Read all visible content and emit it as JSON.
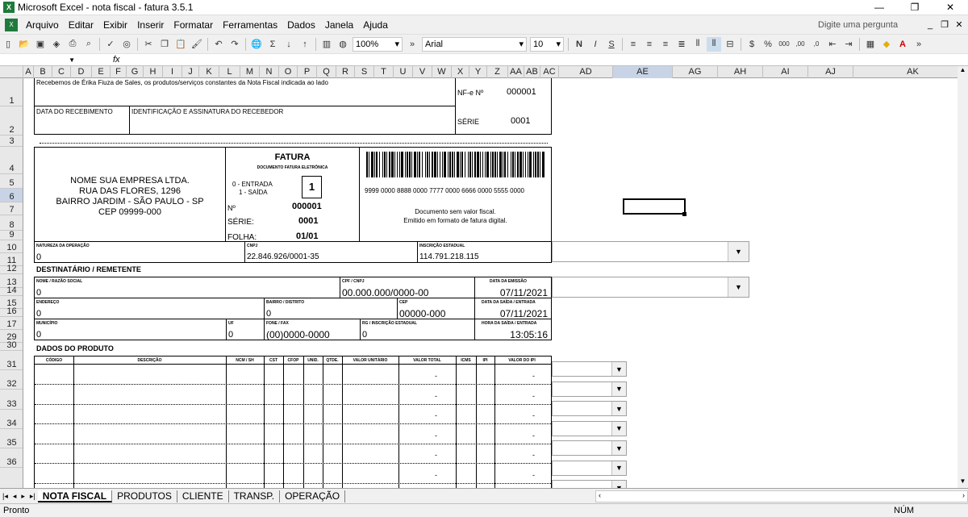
{
  "window": {
    "title": "Microsoft Excel - nota fiscal - fatura 3.5.1",
    "minimize": "—",
    "restore": "❐",
    "close": "✕"
  },
  "menu": {
    "items": [
      "Arquivo",
      "Editar",
      "Exibir",
      "Inserir",
      "Formatar",
      "Ferramentas",
      "Dados",
      "Janela",
      "Ajuda"
    ],
    "help_placeholder": "Digite uma pergunta"
  },
  "toolbar": {
    "zoom": "100%",
    "font": "Arial",
    "size": "10"
  },
  "formula": {
    "fx": "fx"
  },
  "columns": [
    "A",
    "B",
    "C",
    "D",
    "E",
    "F",
    "G",
    "H",
    "I",
    "J",
    "K",
    "L",
    "M",
    "N",
    "O",
    "P",
    "Q",
    "R",
    "S",
    "T",
    "U",
    "V",
    "W",
    "X",
    "Y",
    "Z",
    "AA",
    "AB",
    "AC",
    "AD",
    "AE",
    "AG",
    "AH",
    "AI",
    "AJ",
    "AK"
  ],
  "rows": [
    "1",
    "2",
    "3",
    "4",
    "5",
    "6",
    "7",
    "8",
    "9",
    "10",
    "11",
    "12",
    "13",
    "14",
    "15",
    "16",
    "17",
    "29",
    "30",
    "31",
    "32",
    "33",
    "34",
    "35",
    "36"
  ],
  "receipt": {
    "text": "Recebemos de Érika Fiuza de Sales, os produtos/serviços constantes da Nota Fiscal indicada ao lado",
    "date_label": "DATA DO RECEBIMENTO",
    "sign_label": "IDENTIFICAÇÃO E ASSINATURA DO RECEBEDOR",
    "nfe_label": "NF-e Nº",
    "nfe_value": "000001",
    "serie_label": "SÉRIE",
    "serie_value": "0001"
  },
  "company": {
    "name": "NOME SUA EMPRESA LTDA.",
    "street": "RUA DAS FLORES, 1296",
    "district": "BAIRRO JARDIM - SÃO PAULO - SP",
    "zip": "CEP 09999-000"
  },
  "invoice": {
    "title": "FATURA",
    "subtitle": "DOCUMENTO FATURA ELETRÔNICA",
    "entrada": "0 - ENTRADA",
    "saida": "1 - SAÍDA",
    "type_value": "1",
    "num_label": "Nº",
    "num_value": "000001",
    "serie_label": "SÉRIE:",
    "serie_value": "0001",
    "folha_label": "FOLHA:",
    "folha_value": "01/01"
  },
  "barcode": {
    "digits": "9999 0000 8888 0000 7777 0000 6666 0000 5555 0000",
    "note1": "Documento sem valor fiscal.",
    "note2": "Emitido em formato de fatura digital."
  },
  "nature": {
    "nat_label": "NATUREZA DA OPERAÇÃO",
    "nat_value": "0",
    "cnpj_label": "CNPJ",
    "cnpj_value": "22.846.926/0001-35",
    "ie_label": "INSCRIÇÃO ESTADUAL",
    "ie_value": "114.791.218.115"
  },
  "dest": {
    "section": "DESTINATÁRIO / REMETENTE",
    "name_label": "NOME / RAZÃO SOCIAL",
    "name_value": "0",
    "cpf_label": "CPF / CNPJ",
    "cpf_value": "00.000.000/0000-00",
    "emis_label": "DATA DA EMISSÃO",
    "emis_value": "07/11/2021",
    "addr_label": "ENDEREÇO",
    "addr_value": "0",
    "bairro_label": "BAIRRO / DISTRITO",
    "bairro_value": "0",
    "cep_label": "CEP",
    "cep_value": "00000-000",
    "saida_label": "DATA DA SAÍDA / ENTRADA",
    "saida_value": "07/11/2021",
    "mun_label": "MUNICÍPIO",
    "mun_value": "0",
    "uf_label": "UF",
    "uf_value": "0",
    "fone_label": "FONE / FAX",
    "fone_value": "(00)0000-0000",
    "rg_label": "RG / INSCRIÇÃO ESTADUAL",
    "rg_value": "0",
    "hora_label": "HORA DA SAÍDA / ENTRADA",
    "hora_value": "13:05:16"
  },
  "products": {
    "section": "DADOS DO PRODUTO",
    "headers": [
      "CÓDIGO",
      "DESCRIÇÃO",
      "NCM / SH",
      "CST",
      "CFOP",
      "UNID.",
      "QTDE.",
      "VALOR UNITÁRIO",
      "VALOR TOTAL",
      "ICMS",
      "IPI",
      "VALOR DO IPI"
    ],
    "dash": "-"
  },
  "tabs": [
    "NOTA FISCAL",
    "PRODUTOS",
    "CLIENTE",
    "TRANSP.",
    "OPERAÇÃO"
  ],
  "status": {
    "left": "Pronto",
    "right": "NÚM"
  }
}
